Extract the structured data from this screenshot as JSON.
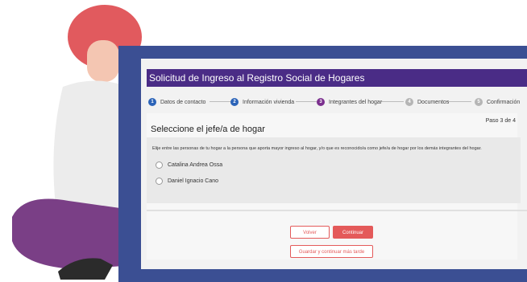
{
  "form": {
    "title": "Solicitud de Ingreso al Registro Social de Hogares",
    "steps": [
      {
        "number": "1",
        "label": "Datos de contacto"
      },
      {
        "number": "2",
        "label": "Información vivienda"
      },
      {
        "number": "3",
        "label": "Integrantes del hogar"
      },
      {
        "number": "4",
        "label": "Documentos"
      },
      {
        "number": "5",
        "label": "Confirmación"
      }
    ],
    "heading": "Seleccione el jefe/a de hogar",
    "page_indicator": "Paso 3 de 4",
    "instruction": "Elije entre las personas de tu hogar a la persona que aporta mayor ingreso al hogar, y/o que es reconocido/a como jefe/a de hogar por los demás integrantes del hogar.",
    "options": [
      {
        "label": "Catalina Andrea Ossa"
      },
      {
        "label": "Daniel Ignacio Cano"
      }
    ],
    "buttons": {
      "back": "Volver",
      "continue": "Continuar",
      "save_later": "Guardar y continuar más tarde"
    }
  },
  "colors": {
    "title_bar": "#4a2c86",
    "step_done": "#2b63b8",
    "step_active": "#7b2f8e",
    "step_pending": "#b5b5b5",
    "accent": "#e45a5a",
    "frame": "#3b4f93"
  }
}
